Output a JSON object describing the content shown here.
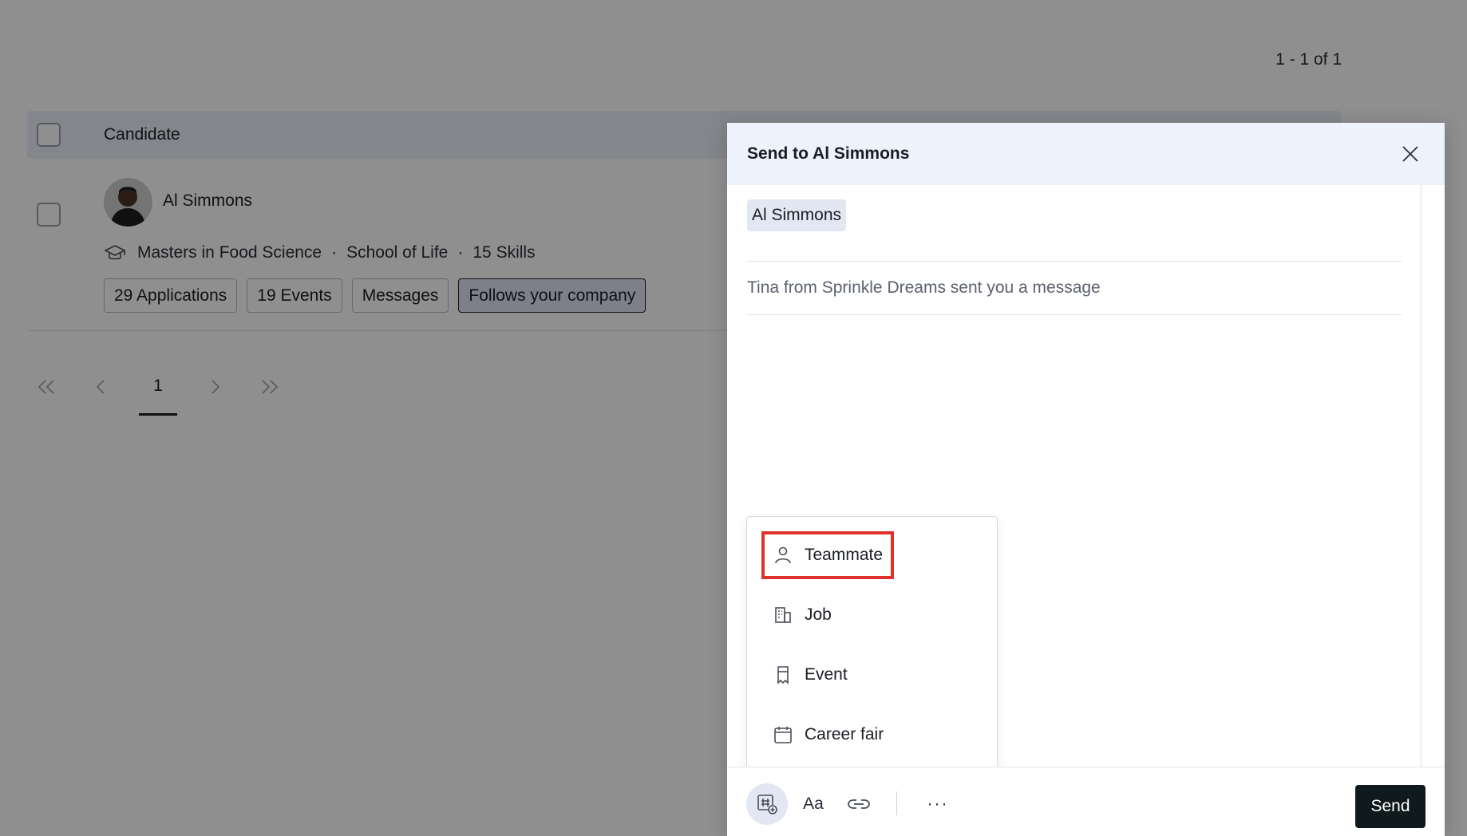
{
  "results": {
    "count": "1 - 1 of 1"
  },
  "table": {
    "header_label": "Candidate",
    "row": {
      "name": "Al Simmons",
      "degree": "Masters in Food Science",
      "school": "School of Life",
      "skills": "15 Skills",
      "separator": "·",
      "tags": [
        "29 Applications",
        "19 Events",
        "Messages",
        "Follows your company"
      ]
    }
  },
  "pagination": {
    "current_page": "1"
  },
  "modal": {
    "title": "Send to Al Simmons",
    "recipient": "Al Simmons",
    "subject": "Tina from Sprinkle Dreams sent you a message"
  },
  "insert_menu": {
    "items": [
      "Teammate",
      "Job",
      "Event",
      "Career fair"
    ],
    "icons": [
      "person-icon",
      "building-icon",
      "ticket-icon",
      "calendar-icon"
    ],
    "highlighted_item": "Teammate"
  },
  "toolbar": {
    "text_format_label": "Aa",
    "more_label": "···",
    "send_label": "Send"
  },
  "colors": {
    "accent_highlight": "#e0322b",
    "send_bg": "#0e1a1c",
    "header_bg": "#eef2fb"
  }
}
